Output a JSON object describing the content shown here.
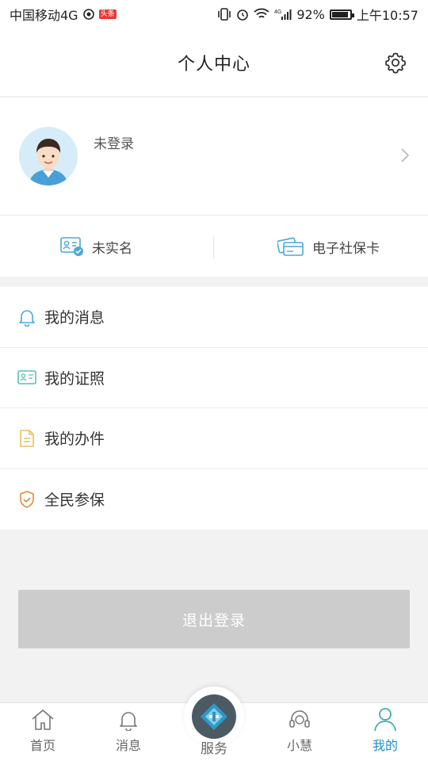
{
  "status_bar": {
    "carrier": "中国移动4G",
    "badge": "头条",
    "network": "4G",
    "battery": "92%",
    "time": "上午10:57"
  },
  "header": {
    "title": "个人中心"
  },
  "profile": {
    "login_status": "未登录"
  },
  "cards": [
    {
      "label": "未实名",
      "icon": "id-card-check-icon"
    },
    {
      "label": "电子社保卡",
      "icon": "social-security-card-icon"
    }
  ],
  "menu": [
    {
      "label": "我的消息",
      "icon": "bell-icon"
    },
    {
      "label": "我的证照",
      "icon": "license-icon"
    },
    {
      "label": "我的办件",
      "icon": "document-icon"
    },
    {
      "label": "全民参保",
      "icon": "shield-check-icon"
    }
  ],
  "logout_label": "退出登录",
  "tabs": [
    {
      "label": "首页",
      "icon": "home-icon"
    },
    {
      "label": "消息",
      "icon": "bell-icon"
    },
    {
      "label": "服务",
      "icon": "service-logo-icon"
    },
    {
      "label": "小慧",
      "icon": "headset-icon"
    },
    {
      "label": "我的",
      "icon": "person-icon"
    }
  ],
  "active_tab": "我的",
  "colors": {
    "accent": "#1a8fc9",
    "logout_bg": "#cccccc",
    "menu_icon_blue": "#4aa8d8",
    "menu_icon_teal": "#5bbfb3",
    "menu_icon_yellow": "#e8c15a",
    "menu_icon_orange": "#e08a3c"
  }
}
